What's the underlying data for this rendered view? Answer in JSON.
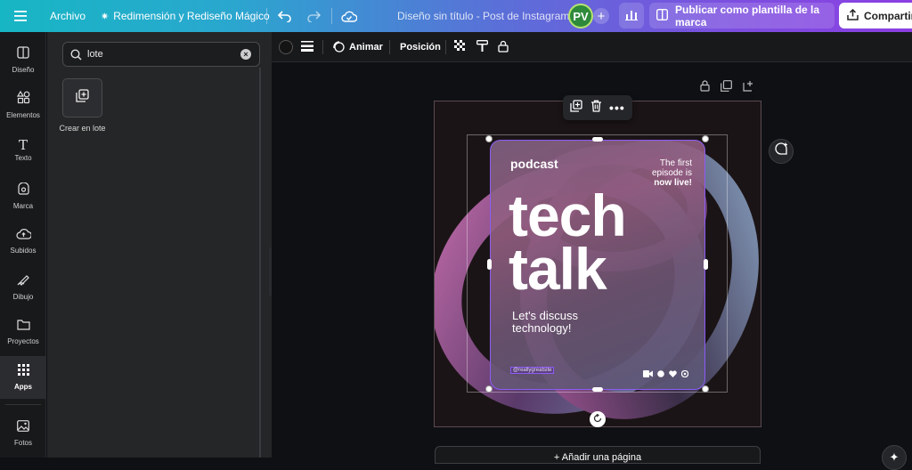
{
  "topbar": {
    "menu_icon": "hamburger-icon",
    "file_label": "Archivo",
    "magic_label": "Redimensión y Rediseño Mágico",
    "doc_title": "Diseño sin título - Post de Instagram",
    "avatar_initials": "PV",
    "publish_template_label": "Publicar como plantilla de la marca",
    "share_label": "Compartir"
  },
  "rail": {
    "items": [
      {
        "label": "Diseño",
        "icon": "layout-icon"
      },
      {
        "label": "Elementos",
        "icon": "shapes-icon"
      },
      {
        "label": "Texto",
        "icon": "text-icon"
      },
      {
        "label": "Marca",
        "icon": "brand-icon"
      },
      {
        "label": "Subidos",
        "icon": "upload-cloud-icon"
      },
      {
        "label": "Dibujo",
        "icon": "draw-icon"
      },
      {
        "label": "Proyectos",
        "icon": "folder-icon"
      },
      {
        "label": "Apps",
        "icon": "apps-grid-icon"
      },
      {
        "label": "Fotos",
        "icon": "photo-icon"
      }
    ],
    "active": "Apps"
  },
  "panel": {
    "search_value": "lote",
    "tile_label": "Crear en lote"
  },
  "toolbar": {
    "animate_label": "Animar",
    "position_label": "Posición"
  },
  "design": {
    "podcast": "podcast",
    "first_episode_line1": "The first",
    "first_episode_line2": "episode is",
    "first_episode_line3": "now live!",
    "headline_1": "tech",
    "headline_2": "talk",
    "discuss_line1": "Let's discuss",
    "discuss_line2": "technology!",
    "website": "@reallygreatsite"
  },
  "canvas": {
    "add_page_label": "+ Añadir una página"
  },
  "colors": {
    "accent": "#8b5cf6",
    "avatar_bg": "#2e8a3a"
  }
}
